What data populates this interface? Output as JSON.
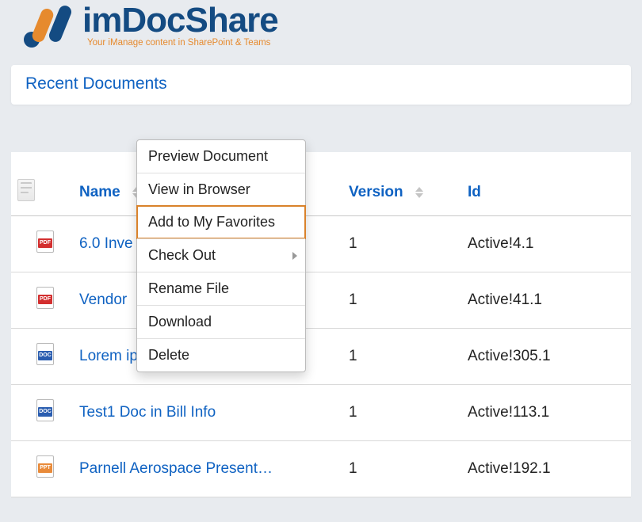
{
  "logo": {
    "name_part1": "im",
    "name_part2": "DocShare",
    "tagline": "Your iManage content in SharePoint & Teams"
  },
  "panel": {
    "title": "Recent Documents"
  },
  "table": {
    "headers": {
      "name": "Name",
      "version": "Version",
      "id": "Id"
    },
    "rows": [
      {
        "icon": "pdf",
        "name": "6.0 Inve",
        "version": "1",
        "id": "Active!4.1"
      },
      {
        "icon": "pdf",
        "name": "Vendor",
        "version": "1",
        "id": "Active!41.1"
      },
      {
        "icon": "doc",
        "name": "Lorem ip",
        "version": "1",
        "id": "Active!305.1"
      },
      {
        "icon": "doc",
        "name": "Test1 Doc in Bill Info",
        "version": "1",
        "id": "Active!113.1"
      },
      {
        "icon": "ppt",
        "name": "Parnell Aerospace Present…",
        "version": "1",
        "id": "Active!192.1"
      }
    ]
  },
  "context_menu": {
    "items": [
      {
        "label": "Preview Document"
      },
      {
        "label": "View in Browser"
      },
      {
        "label": "Add to My Favorites",
        "highlight": true
      },
      {
        "label": "Check Out",
        "has_sub": true
      },
      {
        "label": "Rename File"
      },
      {
        "label": "Download"
      },
      {
        "label": "Delete"
      }
    ]
  }
}
